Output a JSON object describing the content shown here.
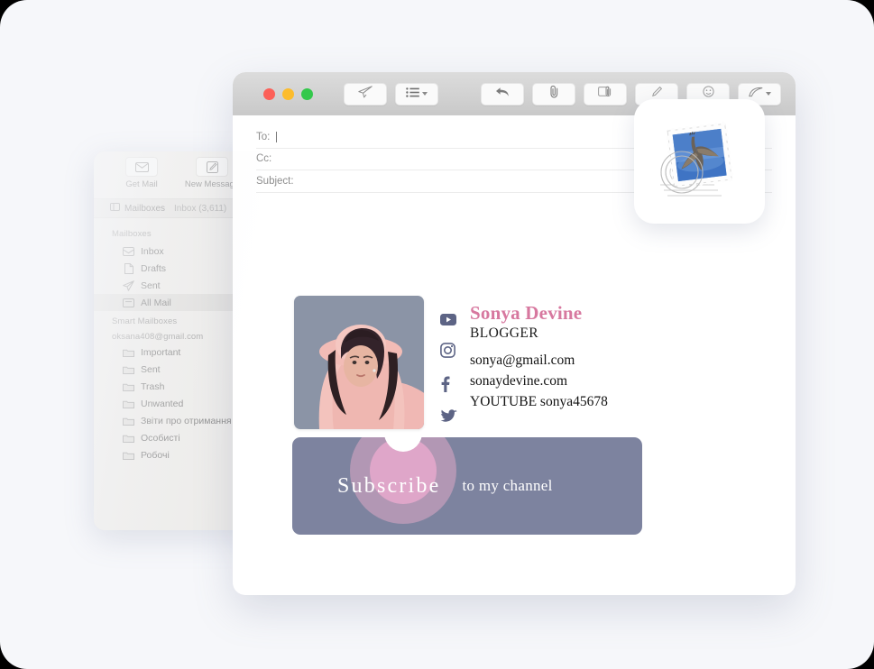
{
  "app": {
    "name": "Mail",
    "icon": "mail-stamp-icon"
  },
  "colors": {
    "canvas": "#f6f7fa",
    "accent_pink": "#d7789f",
    "banner_slate": "#7d839f",
    "circle_pink": "#eaaace",
    "social_icon": "#5d6485",
    "titlebar_top": "#dcdcdc",
    "titlebar_bottom": "#c9c9c9",
    "light_red": "#fc6058",
    "light_yellow": "#fcbc2c",
    "light_green": "#33c84b"
  },
  "main_window": {
    "toolbar": [
      {
        "label": "Get Mail",
        "icon": "envelope-icon"
      },
      {
        "label": "New Message",
        "icon": "compose-pencil-icon"
      }
    ],
    "tabs": [
      {
        "label": "Mailboxes",
        "icon": "sidebar-icon",
        "dim": false
      },
      {
        "label": "Inbox (3,611)",
        "icon": "",
        "dim": true
      }
    ],
    "sidebar": {
      "section1_title": "Mailboxes",
      "section1_items": [
        {
          "label": "Inbox",
          "icon": "inbox-tray-icon",
          "selected": false
        },
        {
          "label": "Drafts",
          "icon": "draft-page-icon",
          "selected": false
        },
        {
          "label": "Sent",
          "icon": "sent-plane-icon",
          "selected": false
        },
        {
          "label": "All Mail",
          "icon": "all-mail-tray-icon",
          "selected": true
        }
      ],
      "section2_title": "Smart Mailboxes",
      "account": "oksana408@gmail.com",
      "section2_items": [
        {
          "label": "Important",
          "icon": "folder-icon"
        },
        {
          "label": "Sent",
          "icon": "folder-icon"
        },
        {
          "label": "Trash",
          "icon": "folder-icon"
        },
        {
          "label": "Unwanted",
          "icon": "folder-icon"
        },
        {
          "label": "Звіти про отримання",
          "icon": "folder-icon"
        },
        {
          "label": "Особисті",
          "icon": "folder-icon"
        },
        {
          "label": "Робочі",
          "icon": "folder-icon"
        }
      ]
    }
  },
  "compose_window": {
    "traffic_lights": [
      "close",
      "minimize",
      "zoom"
    ],
    "toolbar_left": [
      {
        "name": "send-button",
        "icon": "paper-plane-icon"
      },
      {
        "name": "format-list-button",
        "icon": "list-lines-icon",
        "has_caret": true
      }
    ],
    "toolbar_right": [
      {
        "name": "reply-button",
        "icon": "reply-arrow-icon"
      },
      {
        "name": "attach-button",
        "icon": "paperclip-icon"
      },
      {
        "name": "photo-attach-button",
        "icon": "photo-clip-icon"
      },
      {
        "name": "markup-button",
        "icon": "markup-pen-icon"
      },
      {
        "name": "emoji-button",
        "icon": "smiley-icon"
      },
      {
        "name": "stationery-button",
        "icon": "stationery-icon",
        "has_caret": true
      }
    ],
    "fields": [
      {
        "name": "to-field",
        "label": "To:",
        "value": "",
        "has_cursor": true
      },
      {
        "name": "cc-field",
        "label": "Cc:",
        "value": "",
        "has_cursor": false
      },
      {
        "name": "subject-field",
        "label": "Subject:",
        "value": "",
        "has_cursor": false
      }
    ]
  },
  "signature": {
    "portrait_alt": "woman-in-pink-hat-portrait",
    "name": "Sonya Devine",
    "role": "BLOGGER",
    "lines": [
      "sonya@gmail.com",
      "sonaydevine.com",
      "YOUTUBE sonya45678"
    ],
    "socials": [
      {
        "name": "youtube-icon"
      },
      {
        "name": "instagram-icon"
      },
      {
        "name": "facebook-icon"
      },
      {
        "name": "twitter-icon"
      }
    ],
    "banner": {
      "main_text": "Subscribe",
      "sub_text": "to my channel"
    }
  }
}
